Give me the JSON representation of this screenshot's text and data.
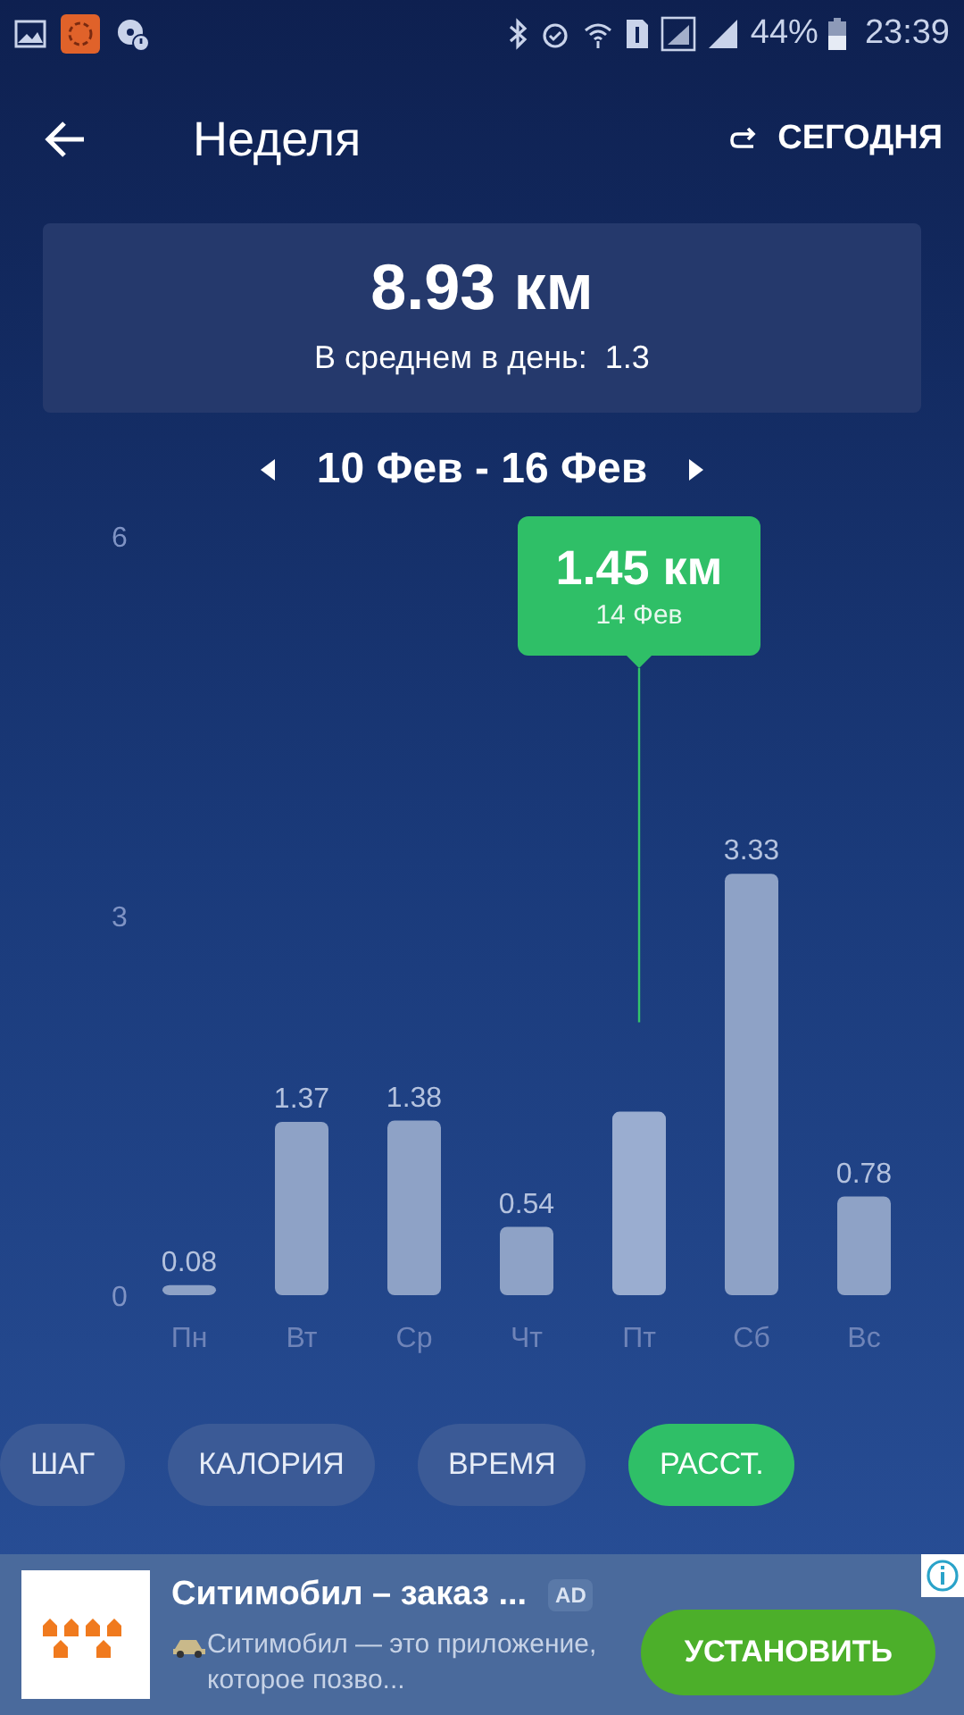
{
  "status_bar": {
    "battery": "44%",
    "time": "23:39"
  },
  "header": {
    "title": "Неделя",
    "action": "СЕГОДНЯ"
  },
  "summary": {
    "total": "8.93 км",
    "average_label": "В среднем в день:",
    "average_value": "1.3"
  },
  "period": {
    "label": "10 Фев - 16 Фев"
  },
  "chart": {
    "tooltip": {
      "value": "1.45 км",
      "date": "14 Фев"
    },
    "selected": [
      false,
      false,
      false,
      false,
      true,
      false,
      false
    ],
    "chart_data": {
      "type": "bar",
      "categories": [
        "Пн",
        "Вт",
        "Ср",
        "Чт",
        "Пт",
        "Сб",
        "Вс"
      ],
      "values": [
        0.08,
        1.37,
        1.38,
        0.54,
        1.45,
        3.33,
        0.78
      ],
      "ylim": [
        0,
        6
      ],
      "yticks": [
        0,
        3,
        6
      ],
      "value_labels": [
        "0.08",
        "1.37",
        "1.38",
        "0.54",
        null,
        "3.33",
        "0.78"
      ]
    }
  },
  "metrics": [
    {
      "label": "ШАГ",
      "selected": false
    },
    {
      "label": "КАЛОРИЯ",
      "selected": false
    },
    {
      "label": "ВРЕМЯ",
      "selected": false
    },
    {
      "label": "РАССТ.",
      "selected": true
    }
  ],
  "ad": {
    "title": "Ситимобил – заказ ...",
    "badge": "AD",
    "text": "Ситимобил — это приложение, которое позво...",
    "button": "УСТАНОВИТЬ"
  }
}
